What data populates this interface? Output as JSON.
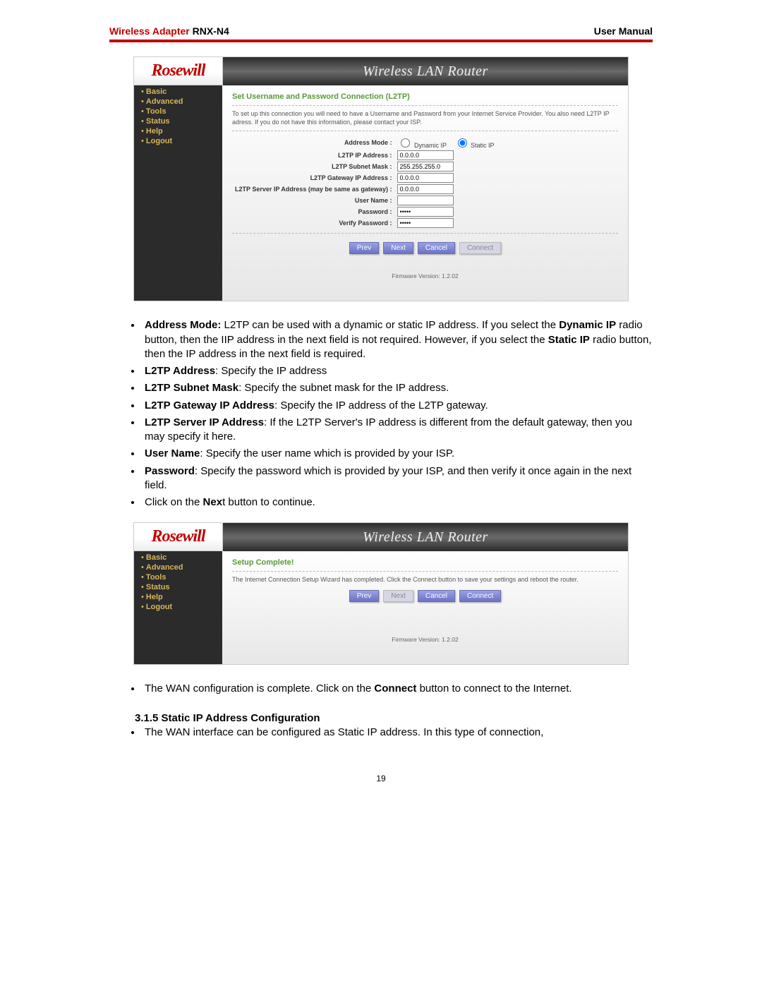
{
  "doc_header": {
    "left_prefix": "Wireless Adapter",
    "left_model": " RNX-N4",
    "right": "User Manual"
  },
  "router": {
    "brand": "Rosewill",
    "title": "Wireless LAN Router",
    "nav": [
      "Basic",
      "Advanced",
      "Tools",
      "Status",
      "Help",
      "Logout"
    ]
  },
  "panel1": {
    "section_title": "Set Username and Password Connection (L2TP)",
    "desc": "To set up this connection you will need to have a Username and Password from your Internet Service Provider. You also need L2TP IP adress. If you do not have this information, please contact your ISP.",
    "fields": {
      "address_mode_label": "Address Mode :",
      "radio_dynamic": "Dynamic IP",
      "radio_static": "Static IP",
      "l2tp_ip_label": "L2TP IP Address :",
      "l2tp_ip_value": "0.0.0.0",
      "subnet_label": "L2TP Subnet Mask :",
      "subnet_value": "255.255.255.0",
      "gateway_label": "L2TP Gateway IP Address :",
      "gateway_value": "0.0.0.0",
      "server_label": "L2TP Server IP Address (may be same as gateway) :",
      "server_value": "0.0.0.0",
      "user_label": "User Name :",
      "user_value": "",
      "pass_label": "Password :",
      "pass_value": "•••••",
      "verify_label": "Verify Password :",
      "verify_value": "•••••"
    },
    "buttons": {
      "prev": "Prev",
      "next": "Next",
      "cancel": "Cancel",
      "connect": "Connect"
    },
    "firmware": "Firmware Version: 1.2.02"
  },
  "doc_list1": {
    "i1_a": "Address Mode:",
    "i1_b": " L2TP can be used with a dynamic or static IP address. If you select the ",
    "i1_c": "Dynamic IP",
    "i1_d": " radio button, then the IIP address in the next field is not required. However, if you select the ",
    "i1_e": "Static IP",
    "i1_f": " radio button, then the IP address in the next field is required.",
    "i2_a": "L2TP Address",
    "i2_b": ": Specify the IP address",
    "i3_a": "L2TP Subnet Mask",
    "i3_b": ": Specify the subnet mask for the IP address.",
    "i4_a": "L2TP Gateway IP Address",
    "i4_b": ": Specify the IP address of the L2TP gateway.",
    "i5_a": "L2TP Server IP Address",
    "i5_b": ": If the L2TP Server's IP address is different from the default gateway, then you may specify it here.",
    "i6_a": "User Name",
    "i6_b": ": Specify the user name which is provided by your ISP.",
    "i7_a": "Password",
    "i7_b": ": Specify the password which is provided by your ISP, and then verify it once again in the next field.",
    "i8_a": "Click on the ",
    "i8_b": "Nex",
    "i8_c": "t button to continue."
  },
  "panel2": {
    "section_title": "Setup Complete!",
    "desc": "The Internet Connection Setup Wizard has completed. Click the Connect button to save your settings and reboot the router.",
    "buttons": {
      "prev": "Prev",
      "next": "Next",
      "cancel": "Cancel",
      "connect": "Connect"
    },
    "firmware": "Firmware Version: 1.2.02"
  },
  "doc_list2": {
    "i1_a": "The WAN configuration is complete. Click on the ",
    "i1_b": "Connect",
    "i1_c": " button to connect to the Internet."
  },
  "section_heading": "3.1.5  Static IP Address Configuration",
  "doc_list3": {
    "i1": "The WAN interface can be configured as Static IP address. In this type of connection,"
  },
  "page_num": "19"
}
